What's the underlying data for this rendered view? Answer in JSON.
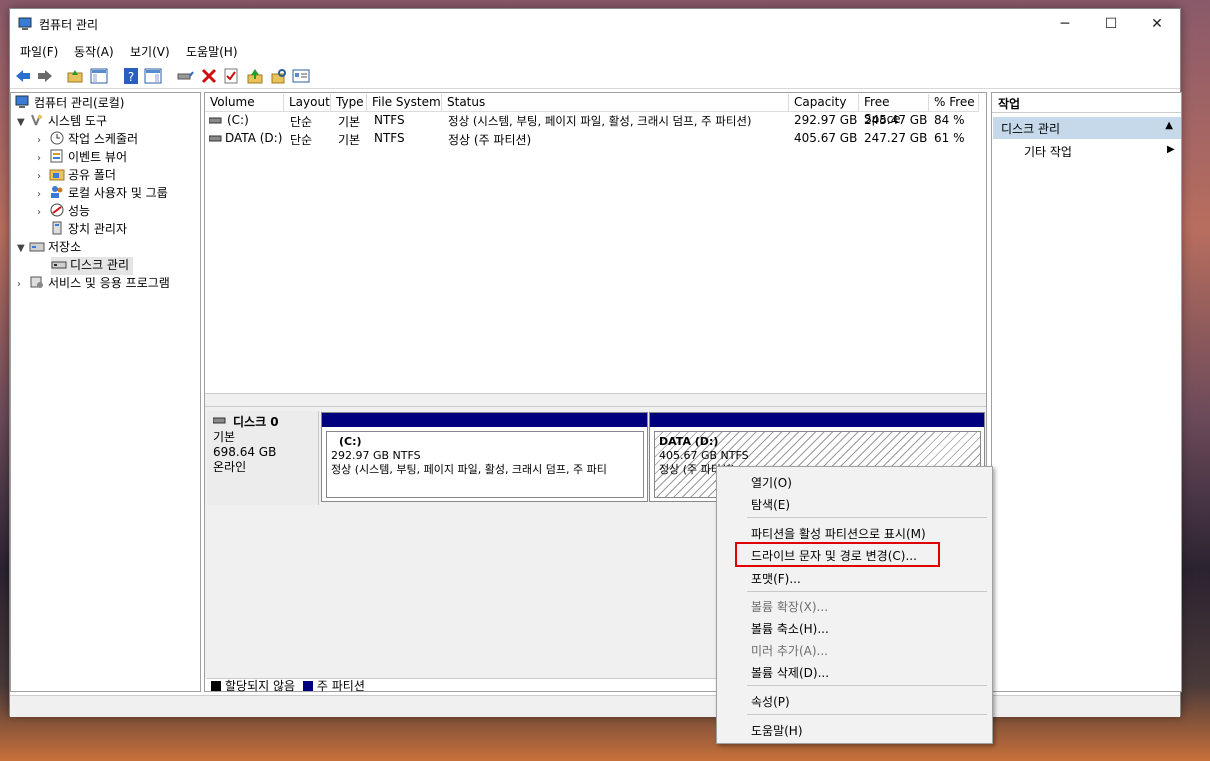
{
  "window": {
    "title": "컴퓨터 관리",
    "controls": [
      "─",
      "☐",
      "✕"
    ]
  },
  "menu": [
    "파일(F)",
    "동작(A)",
    "보기(V)",
    "도움말(H)"
  ],
  "tree": {
    "root": "컴퓨터 관리(로컬)",
    "system_tools": "시스템 도구",
    "task_scheduler": "작업 스케줄러",
    "event_viewer": "이벤트 뷰어",
    "shared_folders": "공유 폴더",
    "local_users": "로컬 사용자 및 그룹",
    "performance": "성능",
    "device_manager": "장치 관리자",
    "storage": "저장소",
    "disk_management": "디스크 관리",
    "services": "서비스 및 응용 프로그램"
  },
  "volumes": {
    "columns": [
      "Volume",
      "Layout",
      "Type",
      "File System",
      "Status",
      "Capacity",
      "Free Space",
      "% Free"
    ],
    "rows": [
      [
        "(C:)",
        "단순",
        "기본",
        "NTFS",
        "정상 (시스템, 부팅, 페이지 파일, 활성, 크래시 덤프, 주 파티션)",
        "292.97 GB",
        "245.47 GB",
        "84 %"
      ],
      [
        "DATA (D:)",
        "단순",
        "기본",
        "NTFS",
        "정상 (주 파티션)",
        "405.67 GB",
        "247.27 GB",
        "61 %"
      ]
    ]
  },
  "disk": {
    "name": "디스크 0",
    "type": "기본",
    "size": "698.64 GB",
    "state": "온라인",
    "partitions": [
      {
        "label": "(C:)",
        "size": "292.97 GB NTFS",
        "status": "정상 (시스템, 부팅, 페이지 파일, 활성, 크래시 덤프, 주 파티"
      },
      {
        "label": "DATA  (D:)",
        "size": "405.67 GB NTFS",
        "status": "정상 (주 파티션)"
      }
    ]
  },
  "legend": {
    "unallocated": "할당되지 않음",
    "primary": "주 파티션"
  },
  "actions": {
    "title": "작업",
    "selected": "디스크 관리",
    "more": "기타 작업"
  },
  "context_menu": {
    "open": "열기(O)",
    "explore": "탐색(E)",
    "mark_active": "파티션을 활성 파티션으로 표시(M)",
    "change_letter": "드라이브 문자 및 경로 변경(C)...",
    "format": "포맷(F)...",
    "extend": "볼륨 확장(X)...",
    "shrink": "볼륨 축소(H)...",
    "add_mirror": "미러 추가(A)...",
    "delete": "볼륨 삭제(D)...",
    "properties": "속성(P)",
    "help": "도움말(H)"
  },
  "colors": {
    "primary_partition": "#00007f",
    "unallocated": "#000000",
    "highlight_box": "#e00000",
    "actions_selected": "#c6d9ea"
  }
}
